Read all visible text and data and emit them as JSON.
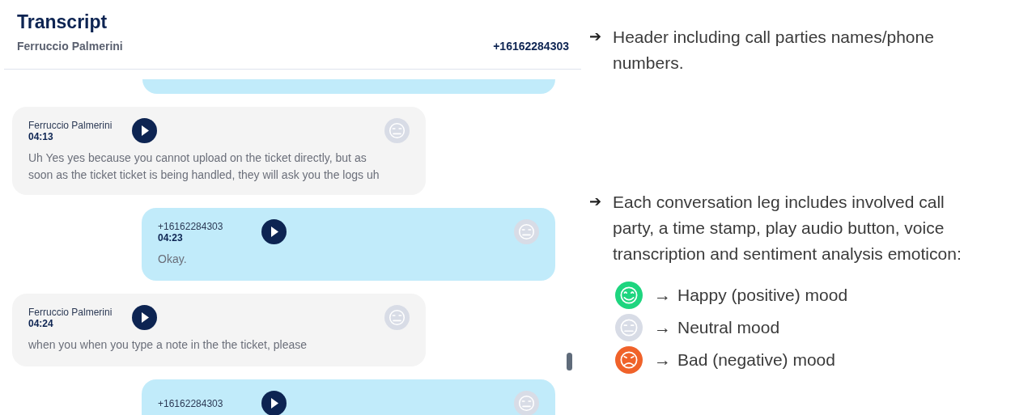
{
  "transcript": {
    "title": "Transcript",
    "caller": "Ferruccio Palmerini",
    "callee": "+16162284303",
    "messages": [
      {
        "kind": "caller",
        "party": "Ferruccio Palmerini",
        "time": "04:13",
        "text": "Uh Yes yes because you cannot upload on the ticket directly, but as soon as the ticket ticket is being handled, they will ask you the logs uh",
        "emoticon": {
          "kind": "neutral",
          "color": "#d8dce6"
        }
      },
      {
        "kind": "callee",
        "party": "+16162284303",
        "time": "04:23",
        "text": "Okay.",
        "emoticon": {
          "kind": "neutral",
          "color": "#d8dce6"
        }
      },
      {
        "kind": "caller",
        "party": "Ferruccio Palmerini",
        "time": "04:24",
        "text": "when you when you type a note in the the ticket, please",
        "emoticon": {
          "kind": "neutral",
          "color": "#d8dce6"
        }
      },
      {
        "kind": "callee",
        "party": "+16162284303",
        "emoticon": {
          "kind": "neutral",
          "color": "#d8dce6"
        }
      }
    ]
  },
  "notes": [
    {
      "bullet": "➔",
      "text": "Header including call parties names/phone numbers."
    },
    {
      "bullet": "➔",
      "text": "Each conversation leg includes involved call party, a time stamp, play audio button, voice transcription and sentiment analysis emoticon:"
    }
  ],
  "legend": [
    {
      "kind": "happy",
      "color": "#1ed57f",
      "arrow": "→",
      "label": "Happy (positive) mood"
    },
    {
      "kind": "neutral",
      "color": "#d8dce6",
      "arrow": "→",
      "label": "Neutral mood"
    },
    {
      "kind": "bad",
      "color": "#f0622a",
      "arrow": "→",
      "label": "Bad (negative) mood"
    }
  ]
}
